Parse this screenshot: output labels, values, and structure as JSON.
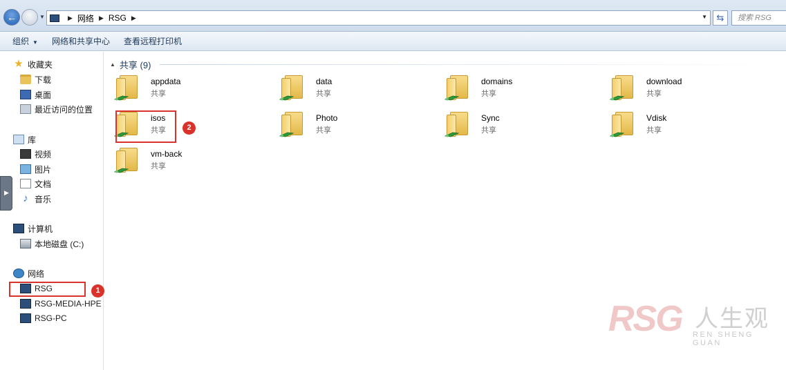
{
  "address_bar": {
    "crumbs": [
      "网络",
      "RSG"
    ],
    "search_placeholder": "搜索 RSG"
  },
  "toolbar": {
    "organize": "组织",
    "network_center": "网络和共享中心",
    "remote_printers": "查看远程打印机"
  },
  "sidebar": {
    "favorites": {
      "title": "收藏夹",
      "items": [
        "下载",
        "桌面",
        "最近访问的位置"
      ]
    },
    "libraries": {
      "title": "库",
      "items": [
        "视频",
        "图片",
        "文档",
        "音乐"
      ]
    },
    "computer": {
      "title": "计算机",
      "items": [
        "本地磁盘 (C:)"
      ]
    },
    "network": {
      "title": "网络",
      "items": [
        "RSG",
        "RSG-MEDIA-HPE",
        "RSG-PC"
      ]
    }
  },
  "annotations": [
    "1",
    "2"
  ],
  "content": {
    "group_title": "共享 (9)",
    "items": [
      {
        "name": "appdata",
        "type": "共享"
      },
      {
        "name": "data",
        "type": "共享"
      },
      {
        "name": "domains",
        "type": "共享"
      },
      {
        "name": "download",
        "type": "共享"
      },
      {
        "name": "isos",
        "type": "共享"
      },
      {
        "name": "Photo",
        "type": "共享"
      },
      {
        "name": "Sync",
        "type": "共享"
      },
      {
        "name": "Vdisk",
        "type": "共享"
      },
      {
        "name": "vm-back",
        "type": "共享"
      }
    ]
  },
  "watermark": {
    "logo": "RSG",
    "cn": "人生观",
    "en": "REN SHENG GUAN"
  },
  "colors": {
    "highlight_red": "#d9322b",
    "link_blue": "#1e395b"
  }
}
